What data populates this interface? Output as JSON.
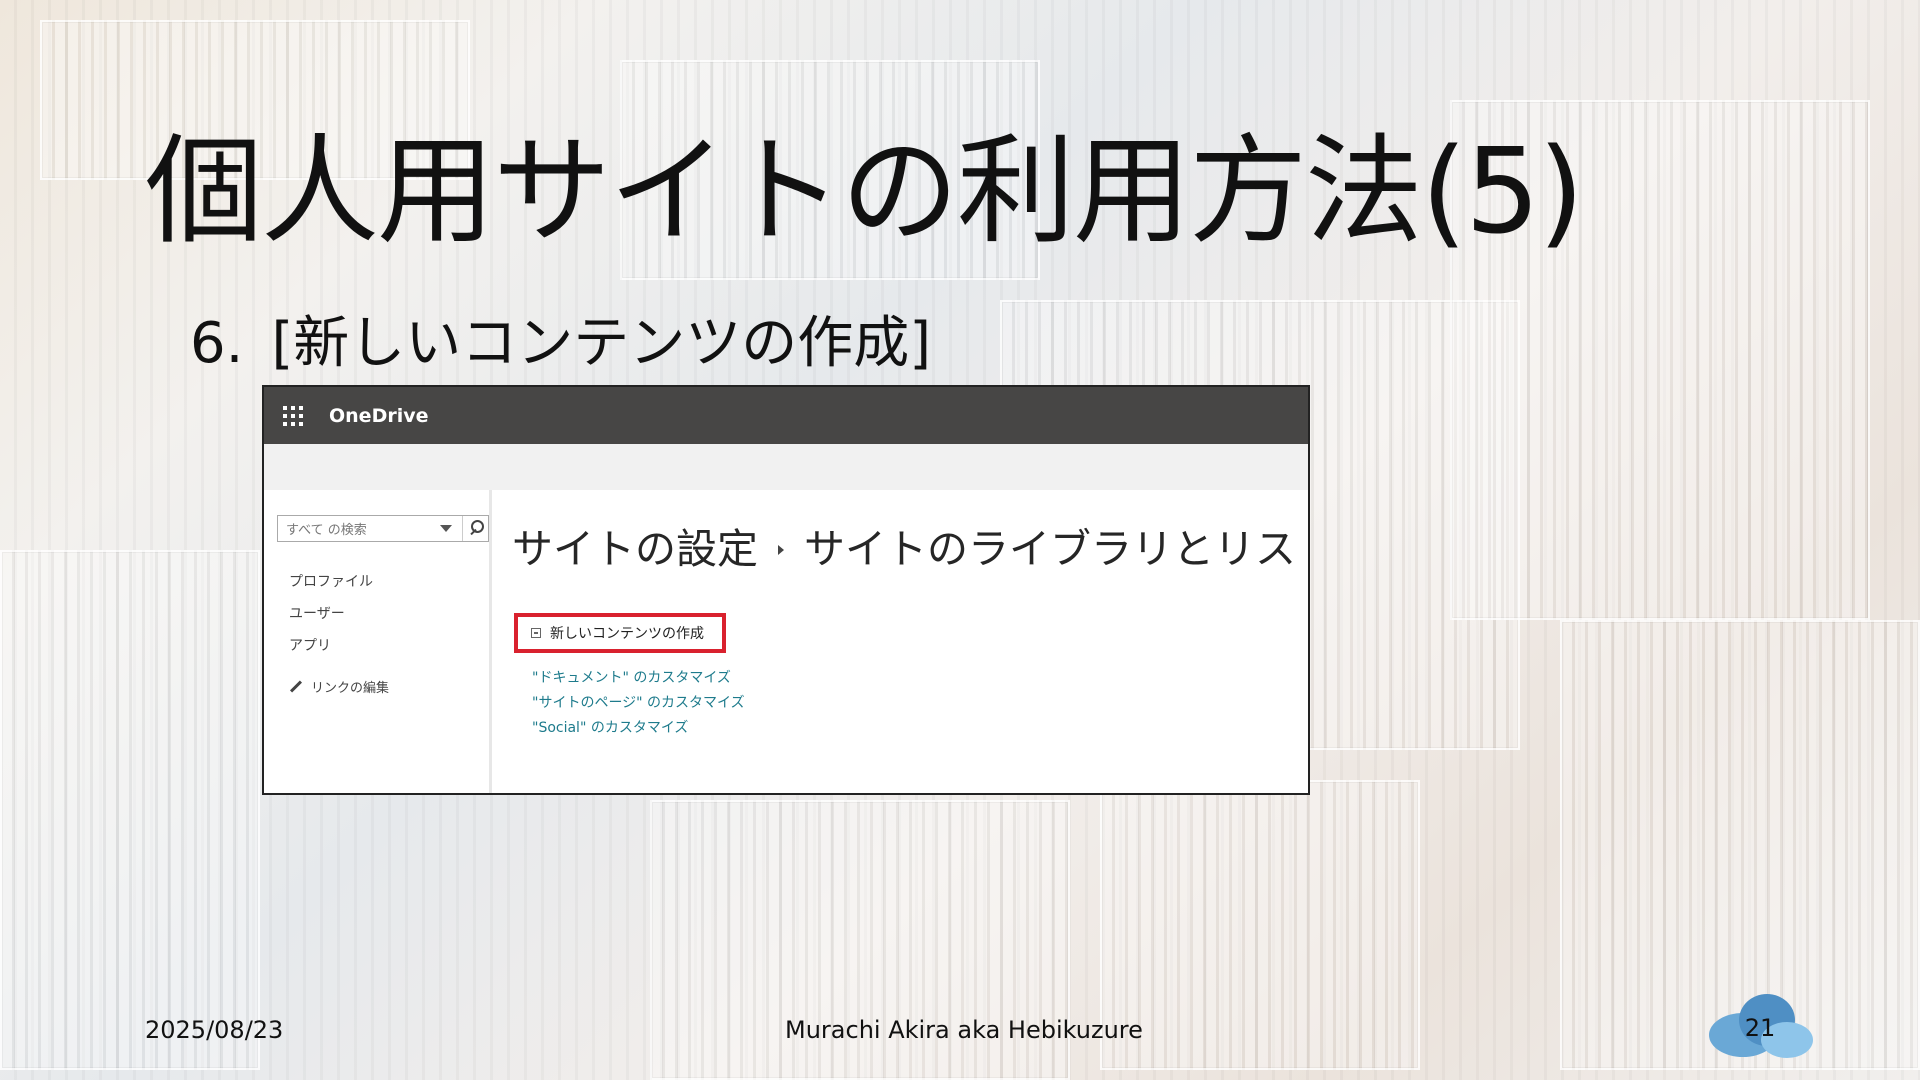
{
  "slide": {
    "title": "個人用サイトの利用方法(5)",
    "step_number": "6.",
    "step_text": "[新しいコンテンツの作成]",
    "date": "2025/08/23",
    "author": "Murachi Akira aka Hebikuzure",
    "page_number": "21"
  },
  "screenshot": {
    "suite_brand": "OneDrive",
    "search": {
      "placeholder": "すべて の検索"
    },
    "nav_items": [
      "プロファイル",
      "ユーザー",
      "アプリ"
    ],
    "edit_links": "リンクの編集",
    "breadcrumb": {
      "parent": "サイトの設定",
      "current": "サイトのライブラリとリスト"
    },
    "new_content_label": "新しいコンテンツの作成",
    "customize_links": [
      "\"ドキュメント\" のカスタマイズ",
      "\"サイトのページ\" のカスタマイズ",
      "\"Social\" のカスタマイズ"
    ],
    "colors": {
      "suitebar": "#474645",
      "highlight_border": "#d9212e",
      "link": "#1e7b8c"
    }
  }
}
